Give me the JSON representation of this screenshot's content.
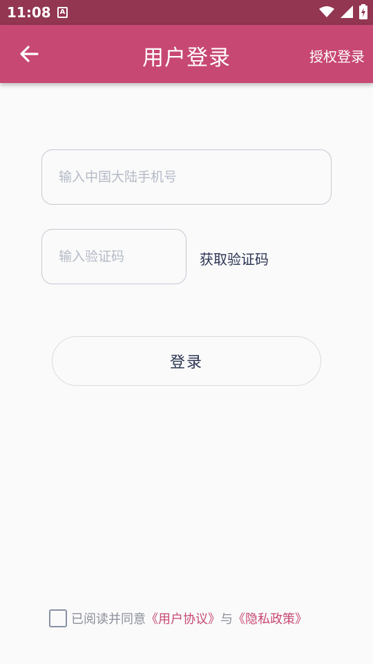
{
  "status_bar": {
    "time": "11:08",
    "notification_glyph": "A",
    "icons": [
      "wifi-icon",
      "signal-icon",
      "battery-charging-icon"
    ]
  },
  "app_bar": {
    "title": "用户登录",
    "action": "授权登录",
    "back_icon": "arrow-left-icon"
  },
  "form": {
    "phone_placeholder": "输入中国大陆手机号",
    "phone_value": "",
    "code_placeholder": "输入验证码",
    "code_value": "",
    "get_code_label": "获取验证码",
    "login_label": "登录"
  },
  "agreement": {
    "checked": false,
    "prefix": "已阅读并同意",
    "user_agreement": "《用户协议》",
    "conjunction": "与",
    "privacy_policy": "《隐私政策》"
  },
  "colors": {
    "status_bar": "#923652",
    "app_bar": "#c74872",
    "link": "#c74872",
    "text_dark": "#2b3552",
    "background": "#fafafa"
  }
}
